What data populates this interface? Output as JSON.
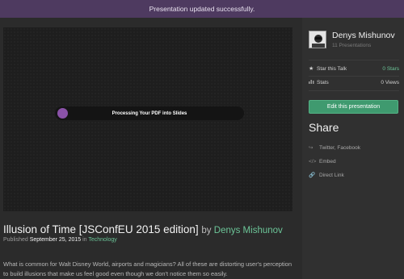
{
  "notice": {
    "text": "Presentation updated successfully."
  },
  "player": {
    "status": "Processing Your PDF into Slides",
    "progress_percent": 5,
    "accent_color": "#8a52a8"
  },
  "talk": {
    "title": "Illusion of Time [JSConfEU 2015 edition]",
    "by": "by",
    "author": "Denys Mishunov",
    "published_label": "Published",
    "date": "September 25, 2015",
    "in": "in",
    "category": "Technology",
    "description": "What is common for Walt Disney World, airports and magicians? All of these are distorting user's perception to build illusions that make us feel good even though we don't notice them so easily."
  },
  "sidebar": {
    "user_name": "Denys Mishunov",
    "user_sub": "11 Presentations",
    "star_label": "Star this Talk",
    "star_value": "0 Stars",
    "stats_label": "Stats",
    "stats_value": "0 Views",
    "edit_button": "Edit this presentation",
    "share_title": "Share",
    "share_items": [
      {
        "label": "Twitter, Facebook",
        "icon": "share-icon"
      },
      {
        "label": "Embed",
        "icon": "code-icon"
      },
      {
        "label": "Direct Link",
        "icon": "link-icon"
      }
    ]
  },
  "colors": {
    "brand_green": "#3f9a6f",
    "link_green": "#6cc598",
    "notice_bg": "#4e3a60"
  }
}
